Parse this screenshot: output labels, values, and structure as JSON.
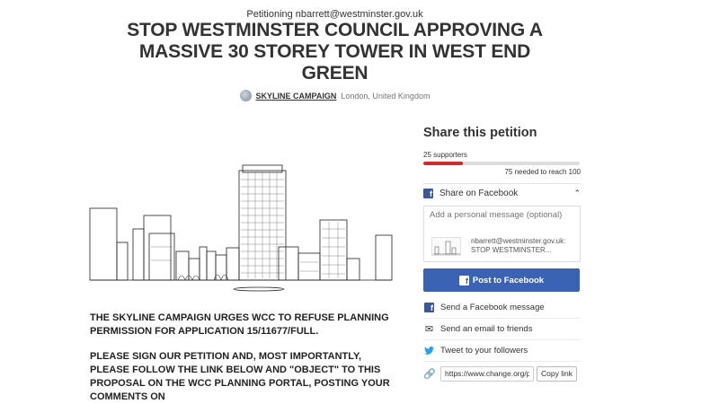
{
  "header": {
    "petitioning": "Petitioning nbarrett@westminster.gov.uk",
    "title": "STOP WESTMINSTER COUNCIL APPROVING A MASSIVE 30 STOREY TOWER IN WEST END GREEN",
    "starter_name": "SKYLINE CAMPAIGN",
    "starter_location": "London, United Kingdom"
  },
  "body": {
    "paragraph1": "THE SKYLINE CAMPAIGN URGES WCC TO REFUSE PLANNING PERMISSION FOR APPLICATION 15/11677/FULL.",
    "paragraph2": "PLEASE SIGN OUR PETITION AND, MOST IMPORTANTLY, PLEASE FOLLOW THE LINK BELOW AND \"OBJECT\" TO THIS PROPOSAL ON THE WCC PLANNING PORTAL, POSTING YOUR COMMENTS ON"
  },
  "share": {
    "title": "Share this petition",
    "supporters_label": "25 supporters",
    "progress_fraction": 0.25,
    "needed_label": "75 needed to reach 100",
    "facebook": {
      "header_label": "Share on Facebook",
      "message_placeholder": "Add a personal message (optional)",
      "preview_text_line1": "nbarrett@westminster.gov.uk:",
      "preview_text_line2": "STOP WESTMINSTER...",
      "post_button": "Post to Facebook"
    },
    "options": [
      {
        "label": "Send a Facebook message",
        "icon": "facebook-icon"
      },
      {
        "label": "Send an email to friends",
        "icon": "envelope-icon"
      },
      {
        "label": "Tweet to your followers",
        "icon": "twitter-bird-icon"
      }
    ],
    "link_value": "https://www.change.org/p/",
    "copy_label": "Copy link"
  },
  "colors": {
    "progress_fill": "#d12b2b",
    "facebook_blue": "#3b63b3",
    "twitter_blue": "#1da1f2"
  }
}
